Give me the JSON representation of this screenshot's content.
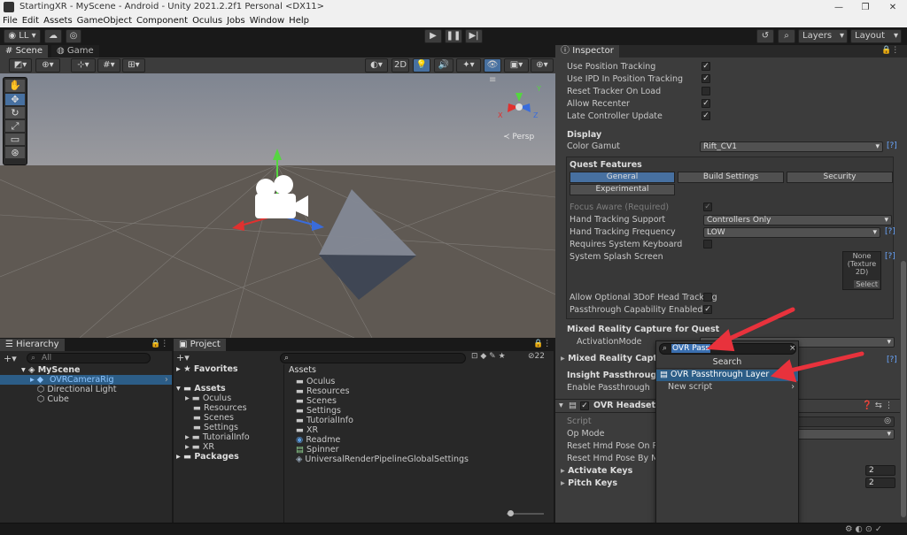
{
  "window": {
    "title": "StartingXR - MyScene - Android - Unity 2021.2.2f1 Personal <DX11>",
    "controls": [
      "—",
      "❐",
      "✕"
    ]
  },
  "menu": [
    "File",
    "Edit",
    "Assets",
    "GameObject",
    "Component",
    "Oculus",
    "Jobs",
    "Window",
    "Help"
  ],
  "toolbar": {
    "account": "LL",
    "layers": "Layers",
    "layout": "Layout"
  },
  "scene_tabs": {
    "scene": "Scene",
    "game": "Game"
  },
  "scene_toolbar": {
    "mode_2d": "2D",
    "persp": "Persp",
    "gizmo_axes": {
      "x": "X",
      "y": "Y",
      "z": "Z"
    }
  },
  "hierarchy": {
    "tab": "Hierarchy",
    "search_placeholder": "All",
    "scene": "MyScene",
    "items": [
      "OVRCameraRig",
      "Directional Light",
      "Cube"
    ]
  },
  "project": {
    "tab": "Project",
    "count": "22",
    "favorites": "Favorites",
    "assets": "Assets",
    "tree": [
      "Oculus",
      "Resources",
      "Scenes",
      "Settings",
      "TutorialInfo",
      "XR"
    ],
    "packages": "Packages",
    "content_header": "Assets",
    "content": [
      "Oculus",
      "Resources",
      "Scenes",
      "Settings",
      "TutorialInfo",
      "XR",
      "Readme",
      "Spinner",
      "UniversalRenderPipelineGlobalSettings"
    ]
  },
  "inspector": {
    "tab": "Inspector",
    "rows_top": [
      {
        "label": "Use Position Tracking",
        "checked": true
      },
      {
        "label": "Use IPD In Position Tracking",
        "checked": true
      },
      {
        "label": "Reset Tracker On Load",
        "checked": false
      },
      {
        "label": "Allow Recenter",
        "checked": true
      },
      {
        "label": "Late Controller Update",
        "checked": true
      }
    ],
    "display_header": "Display",
    "color_gamut_label": "Color Gamut",
    "color_gamut_value": "Rift_CV1",
    "help": "[?]",
    "quest_features": "Quest Features",
    "qf_tabs": [
      "General",
      "Build Settings",
      "Security"
    ],
    "qf_tab2": "Experimental",
    "focus_aware": "Focus Aware (Required)",
    "hand_tracking_support": "Hand Tracking Support",
    "hand_tracking_support_value": "Controllers Only",
    "hand_tracking_freq": "Hand Tracking Frequency",
    "hand_tracking_freq_value": "LOW",
    "requires_keyboard": "Requires System Keyboard",
    "splash": "System Splash Screen",
    "splash_value_1": "None",
    "splash_value_2": "(Texture 2D)",
    "splash_select": "Select",
    "allow_3dof": "Allow Optional 3DoF Head Tracking",
    "passthrough_capability": "Passthrough Capability Enabled",
    "mrc_header": "Mixed Reality Capture for Quest",
    "activation_mode": "ActivationMode",
    "mrc_foldout": "Mixed Reality Capture",
    "insight_header": "Insight Passthrough",
    "enable_passthrough": "Enable Passthrough",
    "headset_emu": "OVR Headset Em",
    "script": "Script",
    "op_mode": "Op Mode",
    "reset_pose_release": "Reset Hmd Pose On Rele",
    "reset_pose_middle": "Reset Hmd Pose By Midd",
    "activate_keys": "Activate Keys",
    "activate_keys_value": "2",
    "pitch_keys": "Pitch Keys",
    "pitch_keys_value": "2"
  },
  "popup": {
    "search_value": "OVR Pass",
    "search_header": "Search",
    "result": "OVR Passthrough Layer",
    "new_script": "New script"
  },
  "colors": {
    "accent": "#4770a0",
    "arrow": "#e8323c",
    "sky": "#8a8f99",
    "ground": "#5a554f"
  }
}
